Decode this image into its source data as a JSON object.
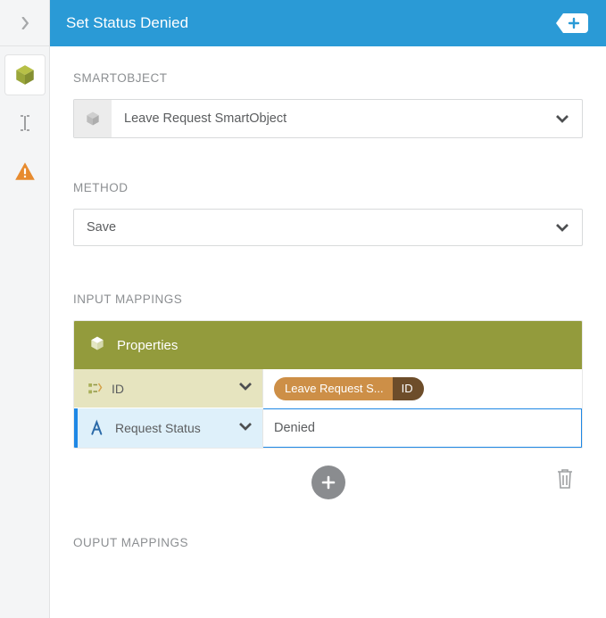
{
  "header": {
    "title": "Set Status Denied"
  },
  "smartobject": {
    "label": "SMARTOBJECT",
    "value": "Leave Request SmartObject"
  },
  "method": {
    "label": "METHOD",
    "value": "Save"
  },
  "inputMappings": {
    "label": "INPUT MAPPINGS",
    "headerTitle": "Properties",
    "rows": [
      {
        "name": "ID",
        "pillSource": "Leave Request S...",
        "pillField": "ID"
      },
      {
        "name": "Request Status",
        "value": "Denied"
      }
    ]
  },
  "outputMappings": {
    "label": "OUPUT MAPPINGS"
  }
}
